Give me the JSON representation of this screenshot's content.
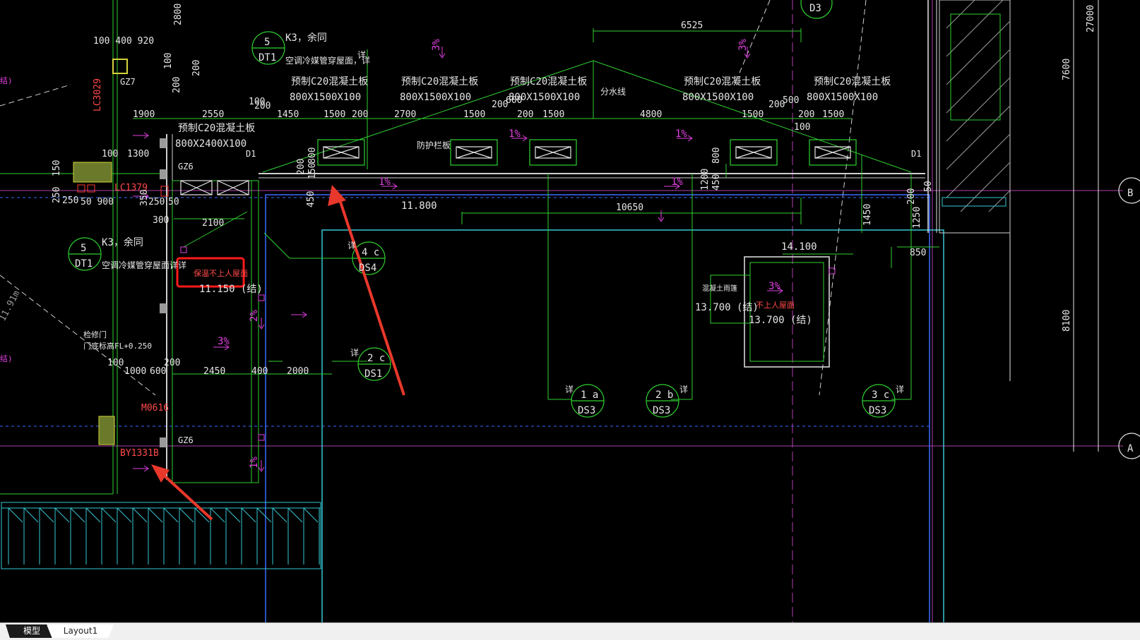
{
  "tabs": {
    "model": "模型",
    "layout1": "Layout1"
  },
  "slabs": {
    "label": "预制C20混凝土板",
    "size": "800X1500X100",
    "size_large": "800X2400X100"
  },
  "notes": {
    "k3": "K3，余同",
    "pipe_left": "空调冷媒管穿屋面，详",
    "pipe_top": "空调冷媒管穿屋面，详",
    "highlight": "保温不上人屋面",
    "noaccess": "不上人屋面",
    "canopy": "混凝土雨篷",
    "access_door": "检修门",
    "door_level": "门底标高FL+0.250",
    "fence": "防护栏板",
    "divide": "分水线",
    "xiang": "详"
  },
  "tags": {
    "gz7": "GZ7",
    "gz6a": "GZ6",
    "gz6b": "GZ6",
    "lc3029": "LC3029",
    "lc1379": "LC1379",
    "m0616": "M0616",
    "by": "BY1331B",
    "d1a": "D1",
    "d1b": "D1"
  },
  "elevations": {
    "e1": "11.800",
    "e2": "11.150 (结)",
    "e3": "14.100",
    "e4": "13.700 (结)",
    "e5": "13.700 (结)"
  },
  "slopes": {
    "s3": "3%",
    "s1": "1%",
    "s2": "2%"
  },
  "dims": {
    "d6525": "6525",
    "d2800": "2800",
    "d27000": "27000",
    "d7600": "7600",
    "d8100": "8100",
    "d100400920": "100 400 920",
    "d100a": "100",
    "d200a": "200",
    "d200b": "200",
    "d1900": "1900",
    "d2550": "2550",
    "d100b": "100",
    "d200c": "200",
    "d1450": "1450",
    "d1500a": "1500",
    "d200d": "200",
    "d2700": "2700",
    "d1500b": "1500",
    "d200e": "200",
    "d600": "600",
    "d200f": "200",
    "d1500c": "1500",
    "d4800": "4800",
    "d1500d": "1500",
    "d200g": "200",
    "d500": "500",
    "d200h": "200",
    "d1500e": "1500",
    "d100c": "100",
    "d1300": "1300",
    "d100d": "100",
    "d150": "150",
    "d250a": "250",
    "d250b": "250",
    "d50900": "50 900",
    "d350": "350",
    "d250c": "250",
    "d50": "50",
    "d300": "300",
    "d2100": "2100",
    "d10650": "10650",
    "d1450b": "1450",
    "d1250": "1250",
    "d850": "850",
    "d200i": "200",
    "d450a": "450",
    "d450b": "450",
    "d800a": "800",
    "d800b": "800",
    "d150b": "150",
    "d1200": "1200",
    "d50b": "50",
    "d200j": "200",
    "d100e": "100",
    "d1000": "1000",
    "d600b": "600",
    "d200k": "200",
    "d2450": "2450",
    "d400": "400",
    "d2000": "2000"
  },
  "callouts": {
    "c5a_top": "5",
    "c5a_bot": "DT1",
    "c5b_top": "5",
    "c5b_bot": "DT1",
    "c4c_top": "4 c",
    "c4c_bot": "DS4",
    "c2c_top": "2 c",
    "c2c_bot": "DS1",
    "c1a_top": "1 a",
    "c1a_bot": "DS3",
    "c2b_top": "2 b",
    "c2b_bot": "DS3",
    "c3c_top": "3 c",
    "c3c_bot": "DS3",
    "d3": "D3"
  },
  "grid": {
    "b": "B",
    "a": "A"
  },
  "side_text": {
    "left1": "结)",
    "left2": "11.91m",
    "left3": "结)"
  },
  "colors": {
    "background": "#000000",
    "green": "#2fd12f",
    "cyan": "#35c7d6",
    "magenta": "#e040e0",
    "highlight_box": "#ff1a1a",
    "arrow": "#e8382b",
    "blue": "#3a6cff"
  }
}
